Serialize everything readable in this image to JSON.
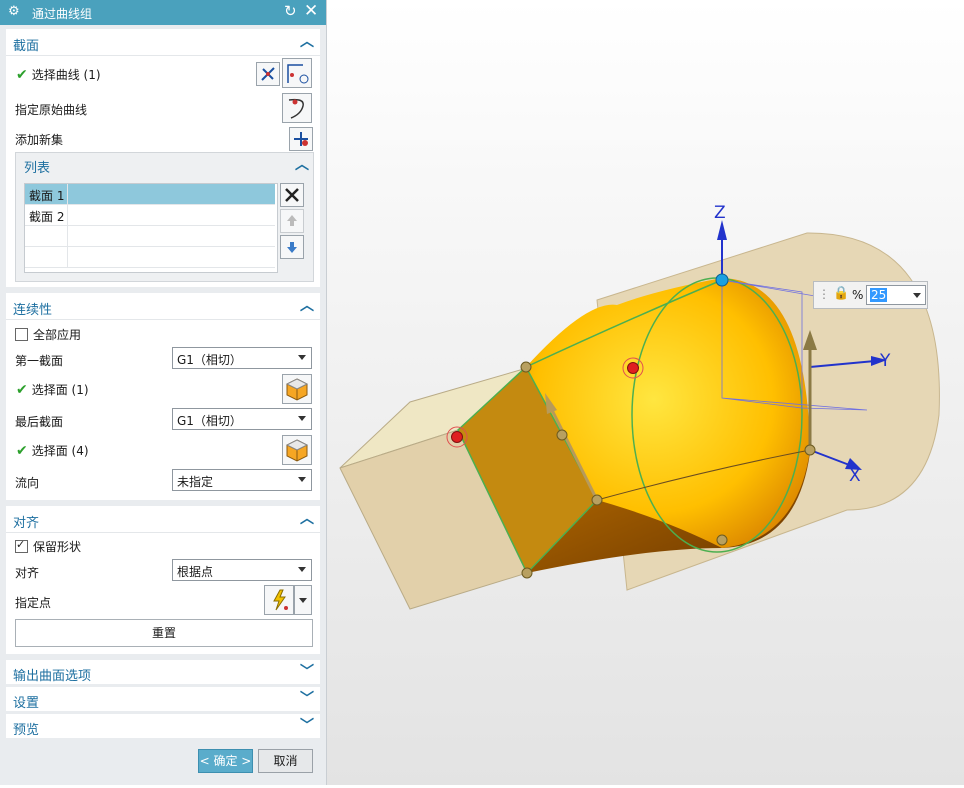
{
  "dialog": {
    "title": "通过曲线组"
  },
  "section_group": {
    "title": "截面",
    "select_curve": "选择曲线 (1)",
    "specify_origin": "指定原始曲线",
    "add_new_set": "添加新集",
    "list": {
      "title": "列表",
      "items": [
        "截面 1",
        "截面 2"
      ]
    }
  },
  "continuity": {
    "title": "连续性",
    "apply_all": "全部应用",
    "first_section_label": "第一截面",
    "first_section_value": "G1（相切）",
    "select_face_1": "选择面 (1)",
    "last_section_label": "最后截面",
    "last_section_value": "G1（相切）",
    "select_face_2": "选择面 (4)",
    "flow_label": "流向",
    "flow_value": "未指定"
  },
  "alignment": {
    "title": "对齐",
    "keep_shape": "保留形状",
    "align_label": "对齐",
    "align_value": "根据点",
    "specify_point": "指定点",
    "reset": "重置"
  },
  "collapsed_groups": [
    "输出曲面选项",
    "设置",
    "预览"
  ],
  "buttons": {
    "ok": "< 确定 >",
    "cancel": "取消"
  },
  "viewport": {
    "axis_z": "Z",
    "axis_y": "Y",
    "axis_x": "X",
    "percent_symbol": "%",
    "percent_value": "25"
  },
  "colors": {
    "accent": "#4aa1bd",
    "surface": "#ffc000",
    "body": "#e6d7b5"
  }
}
